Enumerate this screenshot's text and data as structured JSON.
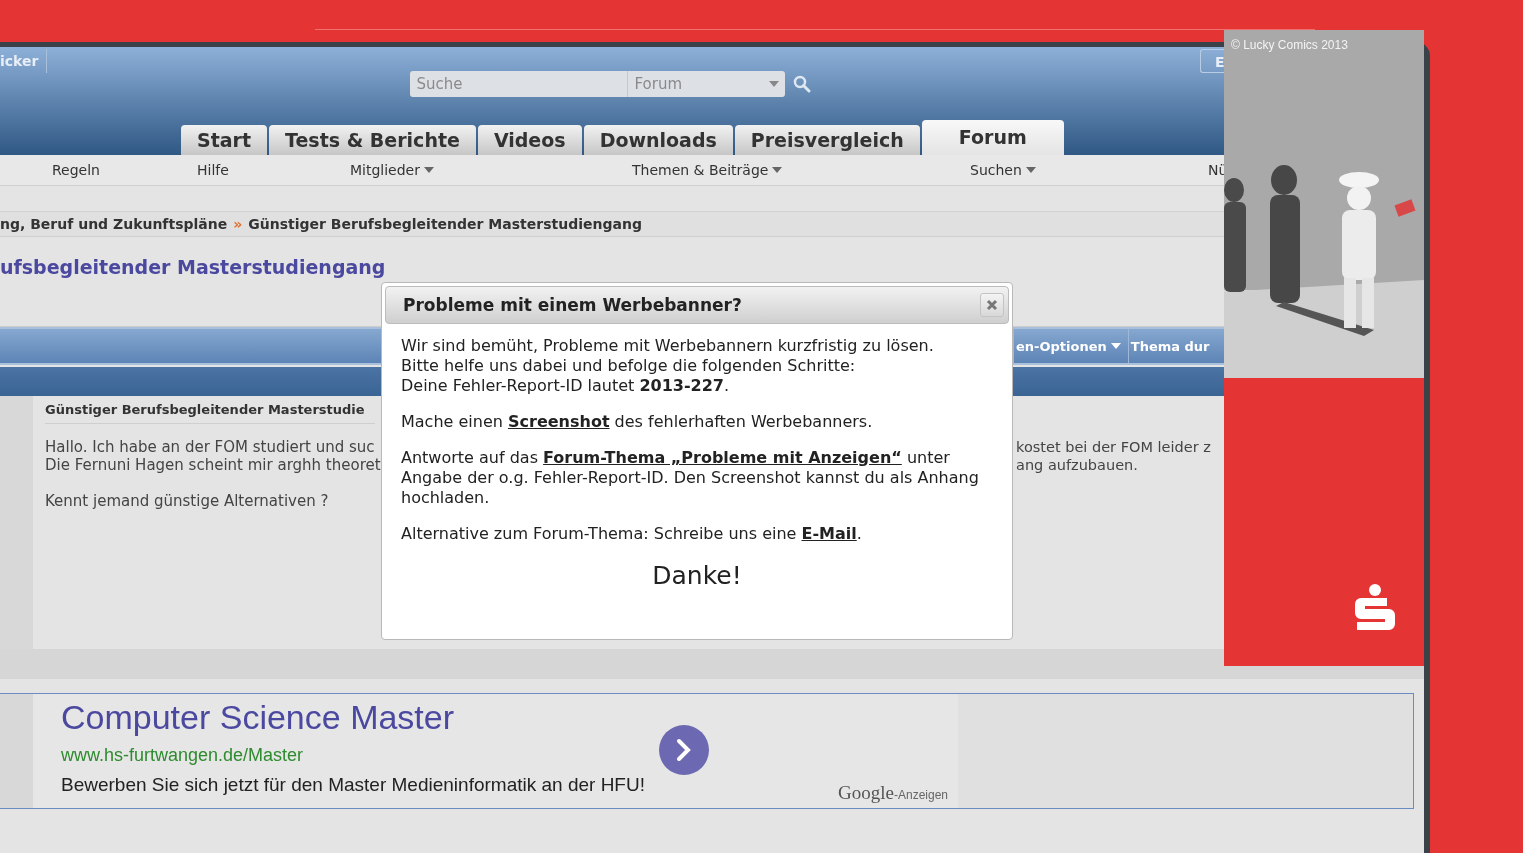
{
  "browser": {
    "header": {
      "left_tab": "icker",
      "right_tab": "E",
      "search": {
        "placeholder": "Suche"
      },
      "scope": {
        "value": "Forum"
      },
      "tabs": [
        {
          "label": "Start",
          "selected": false
        },
        {
          "label": "Tests & Berichte",
          "selected": false
        },
        {
          "label": "Videos",
          "selected": false
        },
        {
          "label": "Downloads",
          "selected": false
        },
        {
          "label": "Preisvergleich",
          "selected": false
        },
        {
          "label": "Forum",
          "selected": true
        }
      ]
    },
    "subnav": [
      {
        "label": "Regeln",
        "dropdown": false
      },
      {
        "label": "Hilfe",
        "dropdown": false
      },
      {
        "label": "Mitglieder",
        "dropdown": true
      },
      {
        "label": "Themen & Beiträge",
        "dropdown": true
      },
      {
        "label": "Suchen",
        "dropdown": true
      },
      {
        "label": "Nü",
        "dropdown": false
      }
    ],
    "breadcrumb": {
      "items": [
        "ng, Beruf und Zukunftspläne",
        "Günstiger Berufsbegleitender Masterstudiengang"
      ],
      "separator": "»"
    },
    "thread_title": "ufsbegleitender Masterstudiengang",
    "thread_tools": [
      {
        "label": "en-Optionen",
        "dropdown": true
      },
      {
        "label": "Thema dur",
        "dropdown": false
      }
    ],
    "post": {
      "title": "Günstiger Berufsbegleitender Masterstudie",
      "left_paragraphs": [
        [
          "Hallo. Ich habe an der FOM studiert und suc",
          "Die Fernuni Hagen scheint mir arghh theoret"
        ],
        [
          "Kennt jemand günstige Alternativen ?"
        ]
      ],
      "right_lines": [
        "kostet bei der FOM leider z",
        "ang aufzubauen."
      ]
    },
    "ad": {
      "title": "Computer Science Master",
      "url": "www.hs-furtwangen.de/Master",
      "text": "Bewerben Sie sich jetzt für den Master Medieninformatik an der HFU!",
      "brand": "Google",
      "label": "-Anzeigen"
    }
  },
  "dialog": {
    "title": "Probleme mit einem Werbebanner?",
    "intro_lines": [
      "Wir sind bemüht, Probleme mit Werbebannern kurzfristig zu lösen.",
      "Bitte helfe uns dabei und befolge die folgenden Schritte:",
      "Deine Fehler-Report-ID lautet **2013-227**."
    ],
    "steps": [
      {
        "before": "Mache einen ",
        "link": "Screenshot",
        "after": " des fehlerhaften Werbebanners."
      },
      {
        "before": "Antworte auf das ",
        "link": "Forum-Thema „Probleme mit Anzeigen“",
        "after": " unter Angabe der o.g. Fehler-Report-ID. Den Screenshot kannst du als Anhang hochladen."
      },
      {
        "before": "Alternative zum Forum-Thema: Schreibe uns eine ",
        "link": "E-Mail",
        "after": "."
      }
    ],
    "thanks": "Danke!"
  },
  "banner": {
    "credit": "© Lucky Comics 2013"
  }
}
